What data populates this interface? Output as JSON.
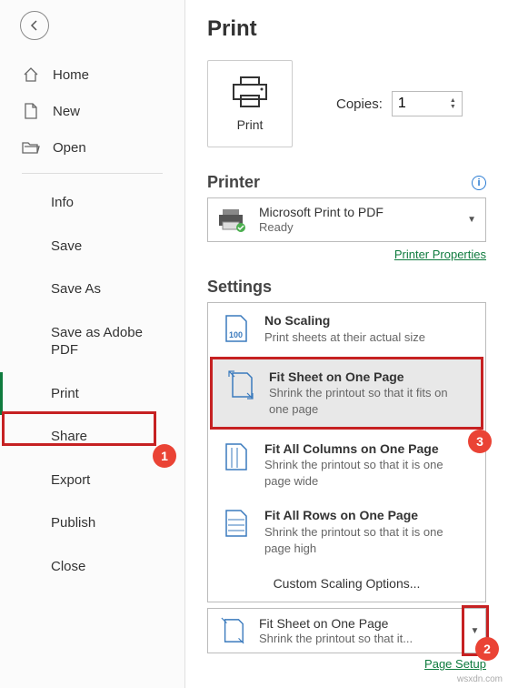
{
  "page_title": "Print",
  "sidebar": {
    "nav": [
      {
        "label": "Home",
        "icon": "home-icon"
      },
      {
        "label": "New",
        "icon": "new-doc-icon"
      },
      {
        "label": "Open",
        "icon": "open-folder-icon"
      }
    ],
    "sub": [
      "Info",
      "Save",
      "Save As",
      "Save as Adobe PDF",
      "Print",
      "Share",
      "Export",
      "Publish",
      "Close"
    ],
    "active": "Print"
  },
  "print_button_label": "Print",
  "copies": {
    "label": "Copies:",
    "value": "1"
  },
  "printer": {
    "section_title": "Printer",
    "name": "Microsoft Print to PDF",
    "status": "Ready",
    "properties_link": "Printer Properties"
  },
  "settings": {
    "section_title": "Settings",
    "options": [
      {
        "title": "No Scaling",
        "sub": "Print sheets at their actual size"
      },
      {
        "title": "Fit Sheet on One Page",
        "sub": "Shrink the printout so that it fits on one page"
      },
      {
        "title": "Fit All Columns on One Page",
        "sub": "Shrink the printout so that it is one page wide"
      },
      {
        "title": "Fit All Rows on One Page",
        "sub": "Shrink the printout so that it is one page high"
      }
    ],
    "custom": "Custom Scaling Options...",
    "selected": {
      "title": "Fit Sheet on One Page",
      "sub": "Shrink the printout so that it..."
    },
    "page_setup_link": "Page Setup"
  },
  "badges": {
    "b1": "1",
    "b2": "2",
    "b3": "3"
  },
  "watermark": "wsxdn.com"
}
